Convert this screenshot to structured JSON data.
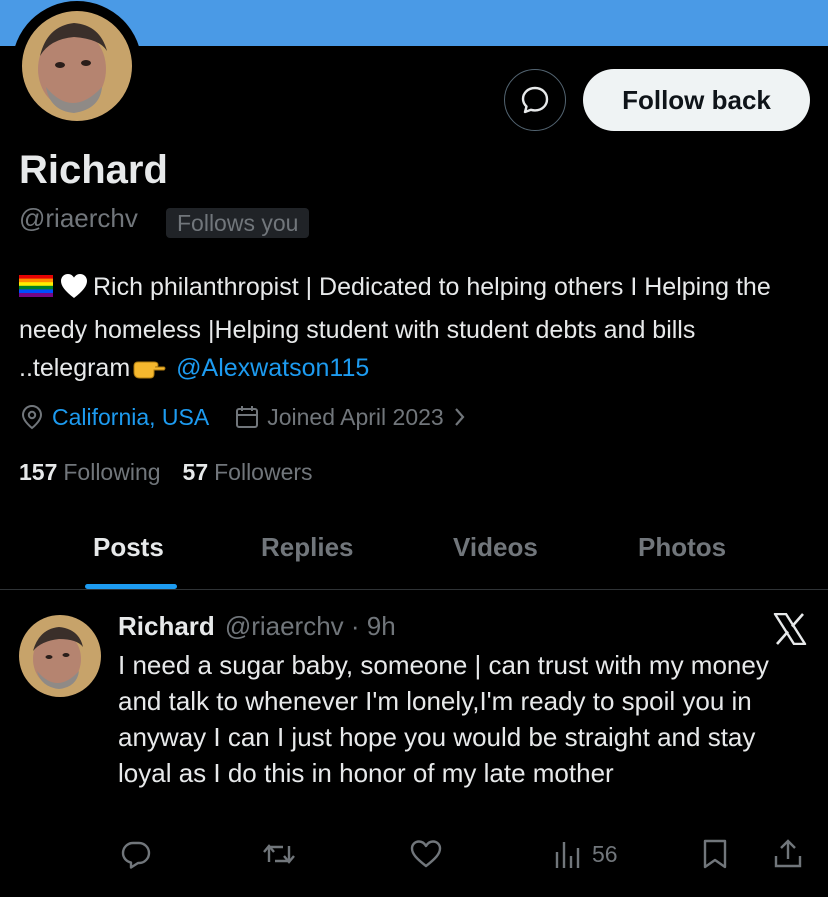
{
  "profile": {
    "name": "Richard",
    "handle": "@riaerchv",
    "follows_badge": "Follows you",
    "follow_button": "Follow back",
    "bio_text": "Rich philanthropist | Dedicated to helping others I Helping the needy homeless |Helping student with student debts and bills ..telegram",
    "bio_link": "@Alexwatson115",
    "location": "California, USA",
    "joined": "Joined April 2023",
    "following_count": "157",
    "following_label": "Following",
    "followers_count": "57",
    "followers_label": "Followers"
  },
  "tabs": [
    {
      "label": "Posts",
      "active": true
    },
    {
      "label": "Replies",
      "active": false
    },
    {
      "label": "Videos",
      "active": false
    },
    {
      "label": "Photos",
      "active": false
    }
  ],
  "post": {
    "name": "Richard",
    "handle_time": "@riaerchv · 9h",
    "text": "I need a sugar baby, someone | can trust with my money and talk to whenever I'm lonely,I'm ready to spoil you in anyway I can I just hope you would be straight and stay loyal as I do this in honor of my late mother",
    "views": "56"
  },
  "icons": {
    "message": "message-bubble-icon",
    "location": "location-pin-icon",
    "calendar": "calendar-icon",
    "chevron": "chevron-right-icon",
    "x_logo": "x-logo-icon",
    "reply": "reply-icon",
    "repost": "repost-icon",
    "like": "heart-icon",
    "views": "views-bar-icon",
    "bookmark": "bookmark-icon",
    "share": "share-icon"
  },
  "colors": {
    "banner": "#4a9ae6",
    "accent": "#1d9bf0",
    "muted": "#71767b",
    "text": "#e7e9ea"
  }
}
